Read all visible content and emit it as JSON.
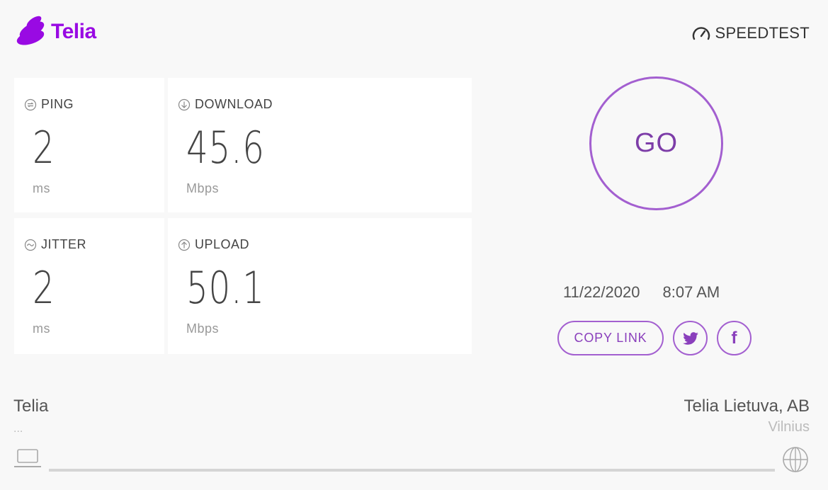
{
  "brand": {
    "name": "Telia",
    "color": "#990ae3",
    "icon": "telia-logo-icon"
  },
  "speedtest": {
    "label": "SPEEDTEST",
    "icon": "speedometer-icon"
  },
  "metrics": {
    "ping": {
      "label": "PING",
      "value": "2",
      "unit": "ms",
      "icon": "ping-icon"
    },
    "download": {
      "label": "DOWNLOAD",
      "value": "45.6",
      "unit": "Mbps",
      "icon": "download-arrow-icon"
    },
    "jitter": {
      "label": "JITTER",
      "value": "2",
      "unit": "ms",
      "icon": "jitter-wave-icon"
    },
    "upload": {
      "label": "UPLOAD",
      "value": "50.1",
      "unit": "Mbps",
      "icon": "upload-arrow-icon"
    }
  },
  "go_button": {
    "label": "GO"
  },
  "result": {
    "date": "11/22/2020",
    "time": "8:07 AM"
  },
  "share": {
    "copy_link_label": "COPY LINK",
    "twitter_icon": "twitter-icon",
    "facebook_icon": "facebook-icon",
    "facebook_glyph": "f"
  },
  "connection": {
    "client_isp": "Telia",
    "client_ip": "...",
    "server_name": "Telia Lietuva, AB",
    "server_city": "Vilnius",
    "client_icon": "laptop-icon",
    "server_icon": "globe-icon"
  },
  "colors": {
    "accent": "#a35fd0",
    "accent_text": "#7d3da8",
    "background": "#f8f8f8",
    "card": "#ffffff"
  }
}
